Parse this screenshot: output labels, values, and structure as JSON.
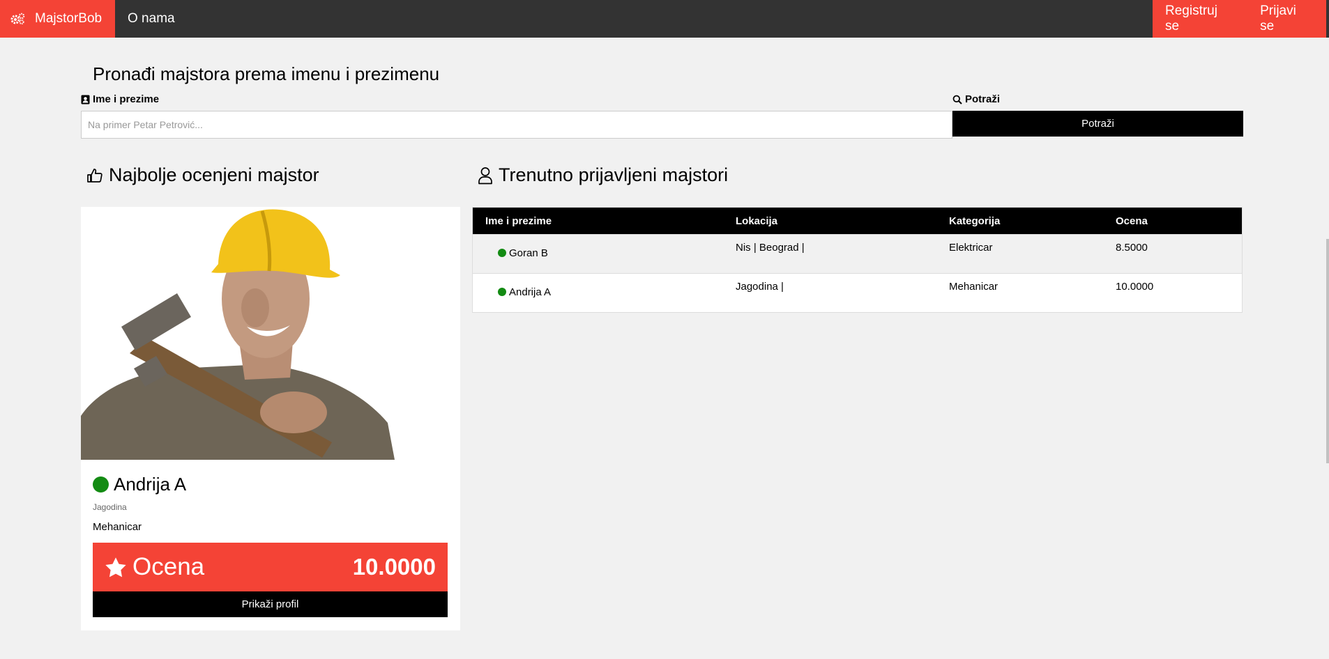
{
  "navbar": {
    "brand": "MajstorBob",
    "brand_icon": "cogs-icon",
    "about": "O nama",
    "register": "Registruj se",
    "login": "Prijavi se",
    "accent_color": "#f44336",
    "bar_color": "#333333"
  },
  "search": {
    "title": "Pronađi majstora prema imenu i prezimenu",
    "name_label": "Ime i prezime",
    "name_label_icon": "address-book-icon",
    "placeholder": "Na primer Petar Petrović...",
    "value": "",
    "action_label": "Potraži",
    "action_label_icon": "search-icon",
    "button": "Potraži"
  },
  "top_rated": {
    "heading": "Najbolje ocenjeni majstor",
    "heading_icon": "thumbs-up-icon",
    "name": "Andrija A",
    "status": "online",
    "status_color": "#138b13",
    "city": "Jagodina",
    "category": "Mehanicar",
    "rating_label": "Ocena",
    "rating_icon": "star-icon",
    "rating": "10.0000",
    "profile_button": "Prikaži profil"
  },
  "online_list": {
    "heading": "Trenutno prijavljeni majstori",
    "heading_icon": "user-icon",
    "columns": [
      "Ime i prezime",
      "Lokacija",
      "Kategorija",
      "Ocena"
    ],
    "rows": [
      {
        "name": "Goran B",
        "location": "Nis | Beograd |",
        "category": "Elektricar",
        "rating": "8.5000"
      },
      {
        "name": "Andrija A",
        "location": "Jagodina |",
        "category": "Mehanicar",
        "rating": "10.0000"
      }
    ]
  }
}
